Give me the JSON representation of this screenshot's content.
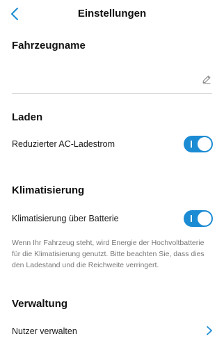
{
  "header": {
    "title": "Einstellungen",
    "back_icon": "chevron-left-icon"
  },
  "vehicle_name": {
    "heading": "Fahrzeugname",
    "value": "",
    "edit_icon": "pencil-icon"
  },
  "charging": {
    "heading": "Laden",
    "reduced_ac_label": "Reduzierter AC-Ladestrom",
    "reduced_ac_enabled": true
  },
  "climate": {
    "heading": "Klimatisierung",
    "battery_label": "Klimatisierung über Batterie",
    "battery_enabled": true,
    "description": "Wenn Ihr Fahrzeug steht, wird Energie der Hochvoltbatterie für die Klimatisierung genutzt. Bitte beachten Sie, dass dies den Ladestand und die Reichweite verringert."
  },
  "management": {
    "heading": "Verwaltung",
    "manage_users_label": "Nutzer verwalten",
    "chevron_icon": "chevron-right-icon"
  },
  "colors": {
    "accent": "#1b8bd4",
    "text": "#1a1a1a",
    "muted": "#777777",
    "divider": "#d9d9d9"
  }
}
